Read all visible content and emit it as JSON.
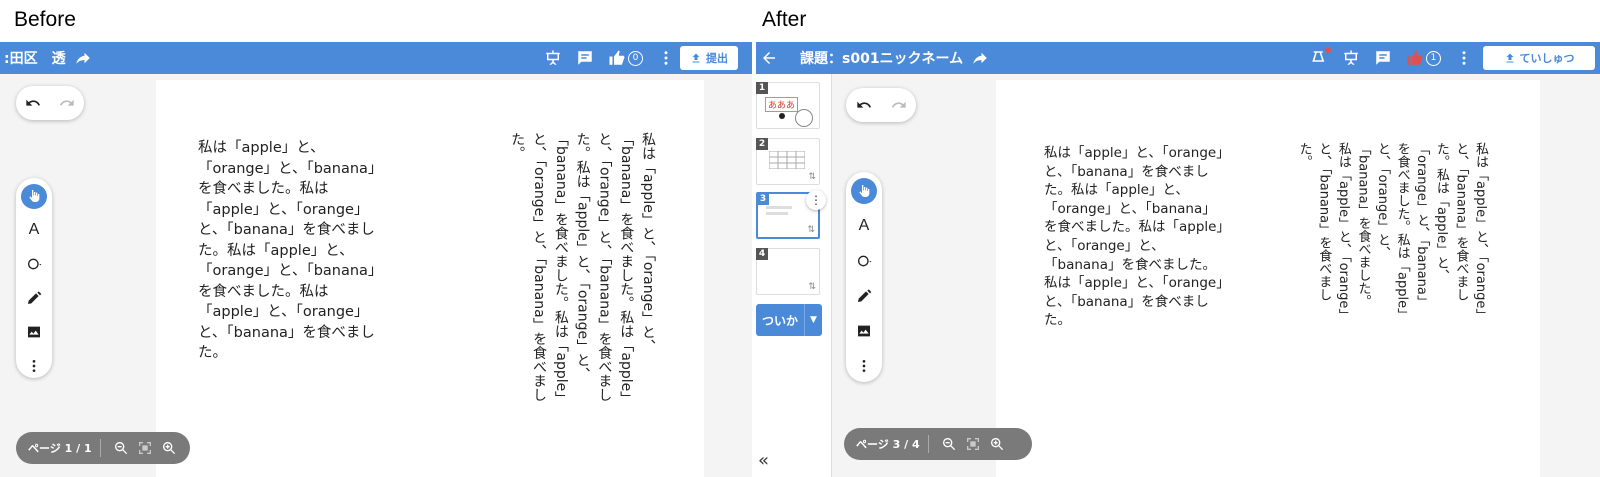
{
  "before": {
    "label": "Before",
    "header": {
      "title": ":田区　透"
    },
    "thumbs_up_count": "0",
    "submit_label": "提出",
    "zoom": {
      "page": "ページ 1 / 1"
    },
    "text_horizontal": "私は「apple」と、「orange」と、「banana」を食べました。私は「apple」と、「orange」と、「banana」を食べました。私は「apple」と、「orange」と、「banana」を食べました。私は「apple」と、「orange」と、「banana」を食べました。",
    "text_vertical": "私は「apple」と、「orange」と、「banana」を食べました。私は「apple」と、「orange」と、「banana」を食べました。私は「apple」と、「orange」と、「banana」を食べました。私は「apple」と、「orange」と、「banana」を食べました。"
  },
  "after": {
    "label": "After",
    "header": {
      "title": "課題：s001ニックネーム"
    },
    "thumbs_up_count": "1",
    "submit_label": "ていしゅつ",
    "zoom": {
      "page": "ページ 3 / 4"
    },
    "pages": [
      {
        "num": "1",
        "thumb_text": "あああ"
      },
      {
        "num": "2"
      },
      {
        "num": "3"
      },
      {
        "num": "4"
      }
    ],
    "add_button_label": "ついか",
    "collapse_label": "«",
    "text_horizontal": "私は「apple」と、「orange」と、「banana」を食べました。私は「apple」と、「orange」と、「banana」を食べました。私は「apple」と、「orange」と、「banana」を食べました。私は「apple」と、「orange」と、「banana」を食べました。",
    "text_vertical": "私は「apple」と、「orange」と、「banana」を食べました。私は「apple」と、「orange」と、「banana」を食べました。私は「apple」と、「orange」と、「banana」を食べました。私は「apple」と、「orange」と、「banana」を食べました。"
  },
  "colors": {
    "accent": "#4a8ad8",
    "like_active": "#e05050"
  },
  "icons": [
    "share-icon",
    "present-icon",
    "comment-icon",
    "thumbs-up-icon",
    "more-icon",
    "upload-icon",
    "undo-icon",
    "redo-icon",
    "pointer-icon",
    "text-icon",
    "shape-icon",
    "pen-icon",
    "image-icon",
    "zoom-out-icon",
    "fit-icon",
    "zoom-in-icon",
    "back-icon",
    "settings-icon"
  ]
}
